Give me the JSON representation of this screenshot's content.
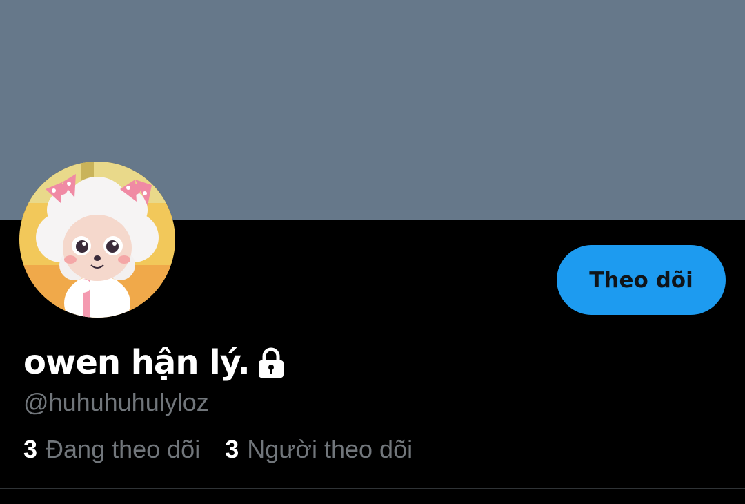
{
  "profile": {
    "display_name": "owen hận lý.",
    "handle": "@huhuhuhulyloz",
    "protected_icon": "lock-icon",
    "avatar_description": "avatar-image"
  },
  "actions": {
    "follow_label": "Theo dõi"
  },
  "stats": {
    "following": {
      "count": "3",
      "label": "Đang theo dõi"
    },
    "followers": {
      "count": "3",
      "label": "Người theo dõi"
    }
  },
  "colors": {
    "banner": "#66788a",
    "background": "#000000",
    "accent": "#1d9bf0",
    "secondary_text": "#71767b"
  }
}
